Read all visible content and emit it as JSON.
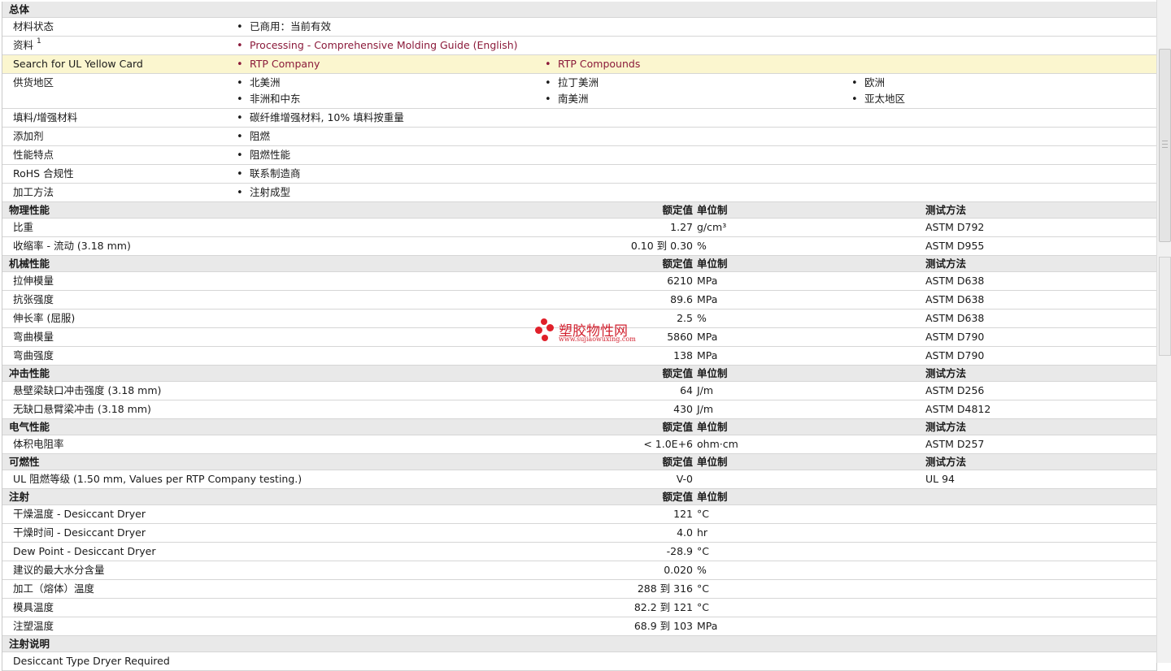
{
  "sections": [
    {
      "type": "info",
      "title": "总体",
      "rows": [
        {
          "label": "材料状态",
          "items": [
            [
              "已商用：当前有效"
            ]
          ],
          "links": false
        },
        {
          "label": "资料",
          "sup": "1",
          "items": [
            [
              "Processing - Comprehensive Molding Guide (English)"
            ]
          ],
          "links": true
        },
        {
          "label": "Search for UL Yellow Card",
          "items": [
            [
              "RTP Company"
            ],
            [
              "RTP Compounds"
            ]
          ],
          "links": true,
          "highlight": true
        },
        {
          "label": "供货地区",
          "items": [
            [
              "北美洲",
              "非洲和中东"
            ],
            [
              "拉丁美洲",
              "南美洲"
            ],
            [
              "欧洲",
              "亚太地区"
            ]
          ],
          "links": false
        },
        {
          "label": "填料/增强材料",
          "items": [
            [
              "碳纤维增强材料, 10% 填料按重量"
            ]
          ],
          "links": false
        },
        {
          "label": "添加剂",
          "items": [
            [
              "阻燃"
            ]
          ],
          "links": false
        },
        {
          "label": "性能特点",
          "items": [
            [
              "阻燃性能"
            ]
          ],
          "links": false
        },
        {
          "label": "RoHS 合规性",
          "items": [
            [
              "联系制造商"
            ]
          ],
          "links": false
        },
        {
          "label": "加工方法",
          "items": [
            [
              "注射成型"
            ]
          ],
          "links": false
        }
      ]
    },
    {
      "type": "prop",
      "title": "物理性能",
      "h_value": "额定值",
      "h_unit": "单位制",
      "h_test": "测试方法",
      "rows": [
        {
          "label": "比重",
          "value": "1.27",
          "unit": "g/cm³",
          "test": "ASTM D792"
        },
        {
          "label": "收缩率  - 流动  (3.18 mm)",
          "value": "0.10 到  0.30",
          "unit": "%",
          "test": "ASTM D955"
        }
      ]
    },
    {
      "type": "prop",
      "title": "机械性能",
      "h_value": "额定值",
      "h_unit": "单位制",
      "h_test": "测试方法",
      "rows": [
        {
          "label": "拉伸模量",
          "value": "6210",
          "unit": "MPa",
          "test": "ASTM D638"
        },
        {
          "label": "抗张强度",
          "value": "89.6",
          "unit": "MPa",
          "test": "ASTM D638"
        },
        {
          "label": "伸长率  (屈服)",
          "value": "2.5",
          "unit": "%",
          "test": "ASTM D638"
        },
        {
          "label": "弯曲模量",
          "value": "5860",
          "unit": "MPa",
          "test": "ASTM D790"
        },
        {
          "label": "弯曲强度",
          "value": "138",
          "unit": "MPa",
          "test": "ASTM D790"
        }
      ]
    },
    {
      "type": "prop",
      "title": "冲击性能",
      "h_value": "额定值",
      "h_unit": "单位制",
      "h_test": "测试方法",
      "rows": [
        {
          "label": "悬壁梁缺口冲击强度  (3.18 mm)",
          "value": "64",
          "unit": "J/m",
          "test": "ASTM D256"
        },
        {
          "label": "无缺口悬臂梁冲击  (3.18 mm)",
          "value": "430",
          "unit": "J/m",
          "test": "ASTM D4812"
        }
      ]
    },
    {
      "type": "prop",
      "title": "电气性能",
      "h_value": "额定值",
      "h_unit": "单位制",
      "h_test": "测试方法",
      "rows": [
        {
          "label": "体积电阻率",
          "value": "< 1.0E+6",
          "unit": "ohm·cm",
          "test": "ASTM D257"
        }
      ]
    },
    {
      "type": "prop",
      "title": "可燃性",
      "h_value": "额定值",
      "h_unit": "单位制",
      "h_test": "测试方法",
      "rows": [
        {
          "label": "UL 阻燃等级  (1.50 mm, Values per RTP Company testing.)",
          "value": "V-0",
          "unit": "",
          "test": "UL 94"
        }
      ]
    },
    {
      "type": "prop",
      "title": "注射",
      "h_value": "额定值",
      "h_unit": "单位制",
      "h_test": "",
      "rows": [
        {
          "label": "干燥温度  - Desiccant Dryer",
          "value": "121",
          "unit": "°C",
          "test": ""
        },
        {
          "label": "干燥时间  - Desiccant Dryer",
          "value": "4.0",
          "unit": "hr",
          "test": ""
        },
        {
          "label": "Dew Point - Desiccant Dryer",
          "value": "-28.9",
          "unit": "°C",
          "test": ""
        },
        {
          "label": "建议的最大水分含量",
          "value": "0.020",
          "unit": "%",
          "test": ""
        },
        {
          "label": "加工（熔体）温度",
          "value": "288 到  316",
          "unit": "°C",
          "test": ""
        },
        {
          "label": "模具温度",
          "value": "82.2 到  121",
          "unit": "°C",
          "test": ""
        },
        {
          "label": "注塑温度",
          "value": "68.9 到  103",
          "unit": "MPa",
          "test": ""
        }
      ]
    },
    {
      "type": "note",
      "title": "注射说明",
      "rows": [
        {
          "label": "Desiccant Type Dryer Required"
        }
      ]
    }
  ],
  "watermark": {
    "text": "塑胶物性网",
    "url": "www.sujiaowuxing.com"
  },
  "colors": {
    "link": "#8b1a3a",
    "section_bg": "#e9e9e9",
    "highlight_bg": "#fbf6cf",
    "watermark": "#d22230"
  }
}
